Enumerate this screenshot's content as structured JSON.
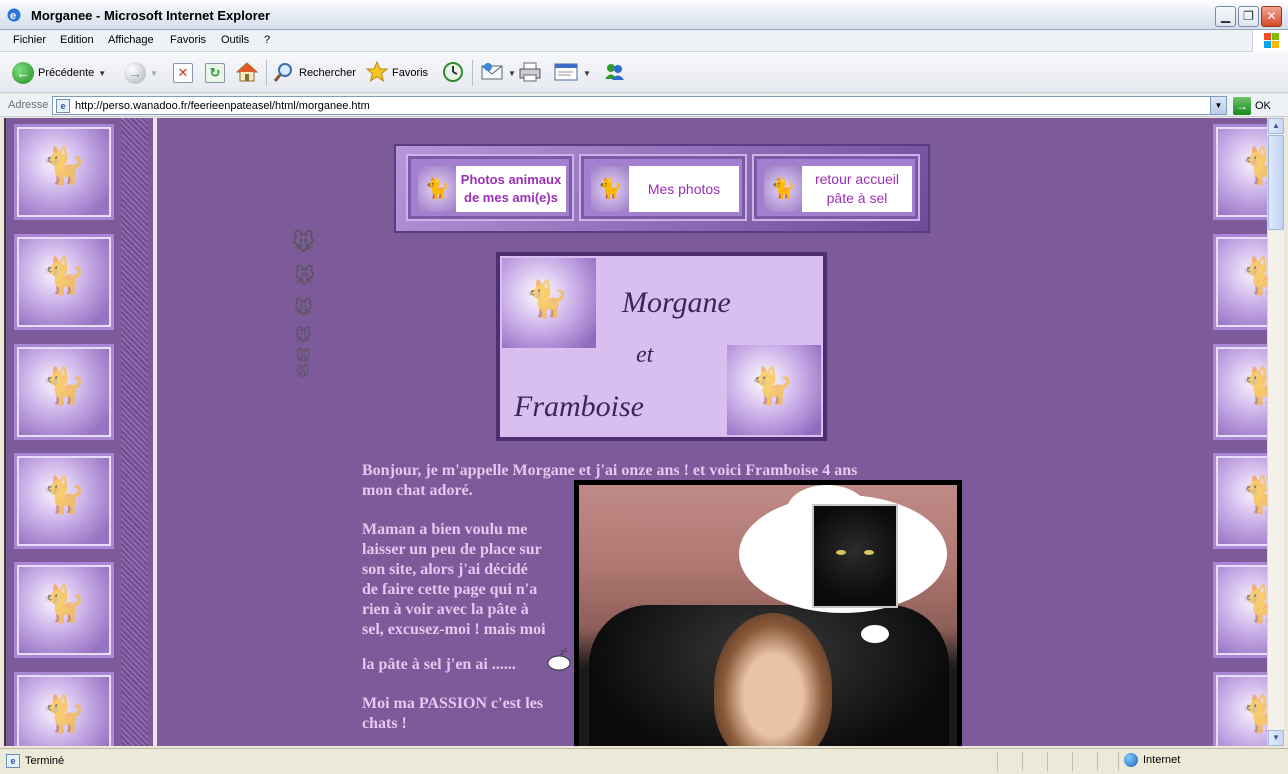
{
  "window": {
    "title": "Morganee - Microsoft Internet Explorer",
    "min_glyph": "▁",
    "max_glyph": "❐",
    "close_glyph": "✕"
  },
  "menu": [
    "Fichier",
    "Edition",
    "Affichage",
    "Favoris",
    "Outils",
    "?"
  ],
  "toolbar": {
    "back_label": "Précédente",
    "search_label": "Rechercher",
    "favorites_label": "Favoris"
  },
  "address": {
    "label": "Adresse",
    "url": "http://perso.wanadoo.fr/feerieenpateasel/html/morganee.htm",
    "go_label": "OK"
  },
  "nav": {
    "link1_line1": "Photos animaux",
    "link1_line2": "de mes ami(e)s",
    "link2": "Mes photos",
    "link3_line1": "retour accueil",
    "link3_line2": "pâte à sel"
  },
  "banner": {
    "word1": "Morgane",
    "word2": "et",
    "word3": "Framboise"
  },
  "content": {
    "intro_line1": "Bonjour, je m'appelle Morgane et j'ai onze ans ! et voici Framboise 4 ans",
    "intro_line2": "mon chat adoré.",
    "p2": [
      "Maman a bien voulu me",
      "laisser un peu de place sur",
      "son site, alors j'ai décidé",
      "de faire cette page qui n'a",
      "rien à voir avec la pâte à",
      "sel, excusez-moi ! mais moi"
    ],
    "p3": "la pâte à sel j'en ai ......",
    "p4": [
      "Moi ma PASSION c'est les",
      "chats !"
    ]
  },
  "status": {
    "text": "Terminé",
    "zone": "Internet"
  },
  "colors": {
    "page_bg": "#7d5a9a",
    "text_pink": "#e6c7f0",
    "link_purple": "#9b2fb5"
  }
}
